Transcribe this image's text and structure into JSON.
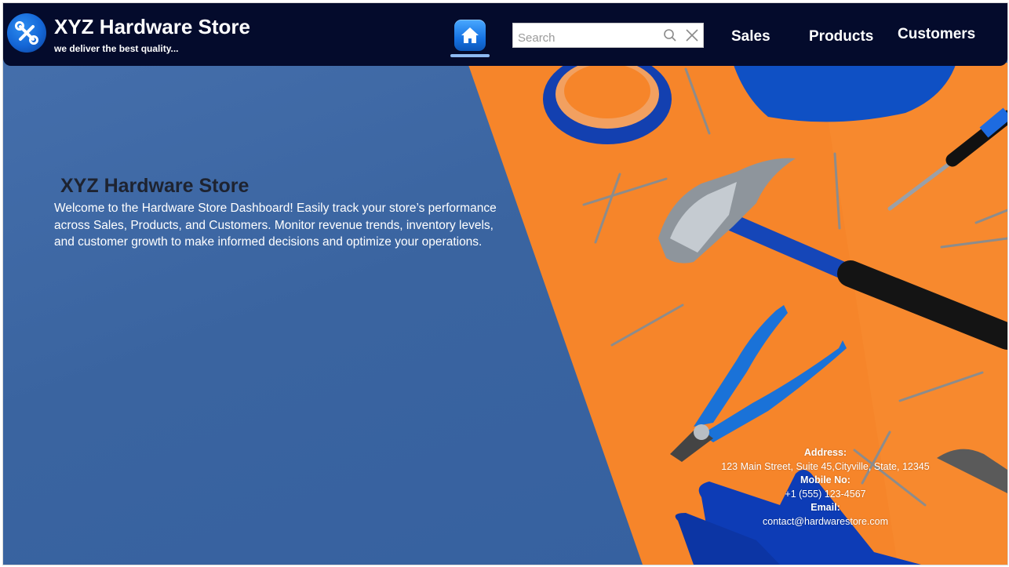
{
  "header": {
    "brand_title": "XYZ Hardware Store",
    "brand_tagline": "we deliver the best quality...",
    "logo_icon": "tools-icon",
    "home_icon": "home-icon",
    "search": {
      "placeholder": "Search",
      "value": ""
    },
    "nav": {
      "sales": "Sales",
      "products": "Products",
      "customers": "Customers"
    }
  },
  "hero": {
    "title": "XYZ Hardware Store",
    "description": "Welcome to the Hardware Store Dashboard! Easily track your store’s performance across Sales, Products, and Customers. Monitor revenue trends, inventory levels, and customer growth to make informed decisions and optimize your operations."
  },
  "contact": {
    "address_label": "Address:",
    "address_value": "123 Main Street, Suite 45,Cityville, State, 12345",
    "mobile_label": "Mobile No:",
    "mobile_value": "+1 (555) 123-4567",
    "email_label": "Email:",
    "email_value": "contact@hardwarestore.com"
  },
  "colors": {
    "navbar": "#040b2c",
    "background_blue": "#3c66a2",
    "background_orange": "#f58424",
    "accent_blue": "#1673e3"
  }
}
